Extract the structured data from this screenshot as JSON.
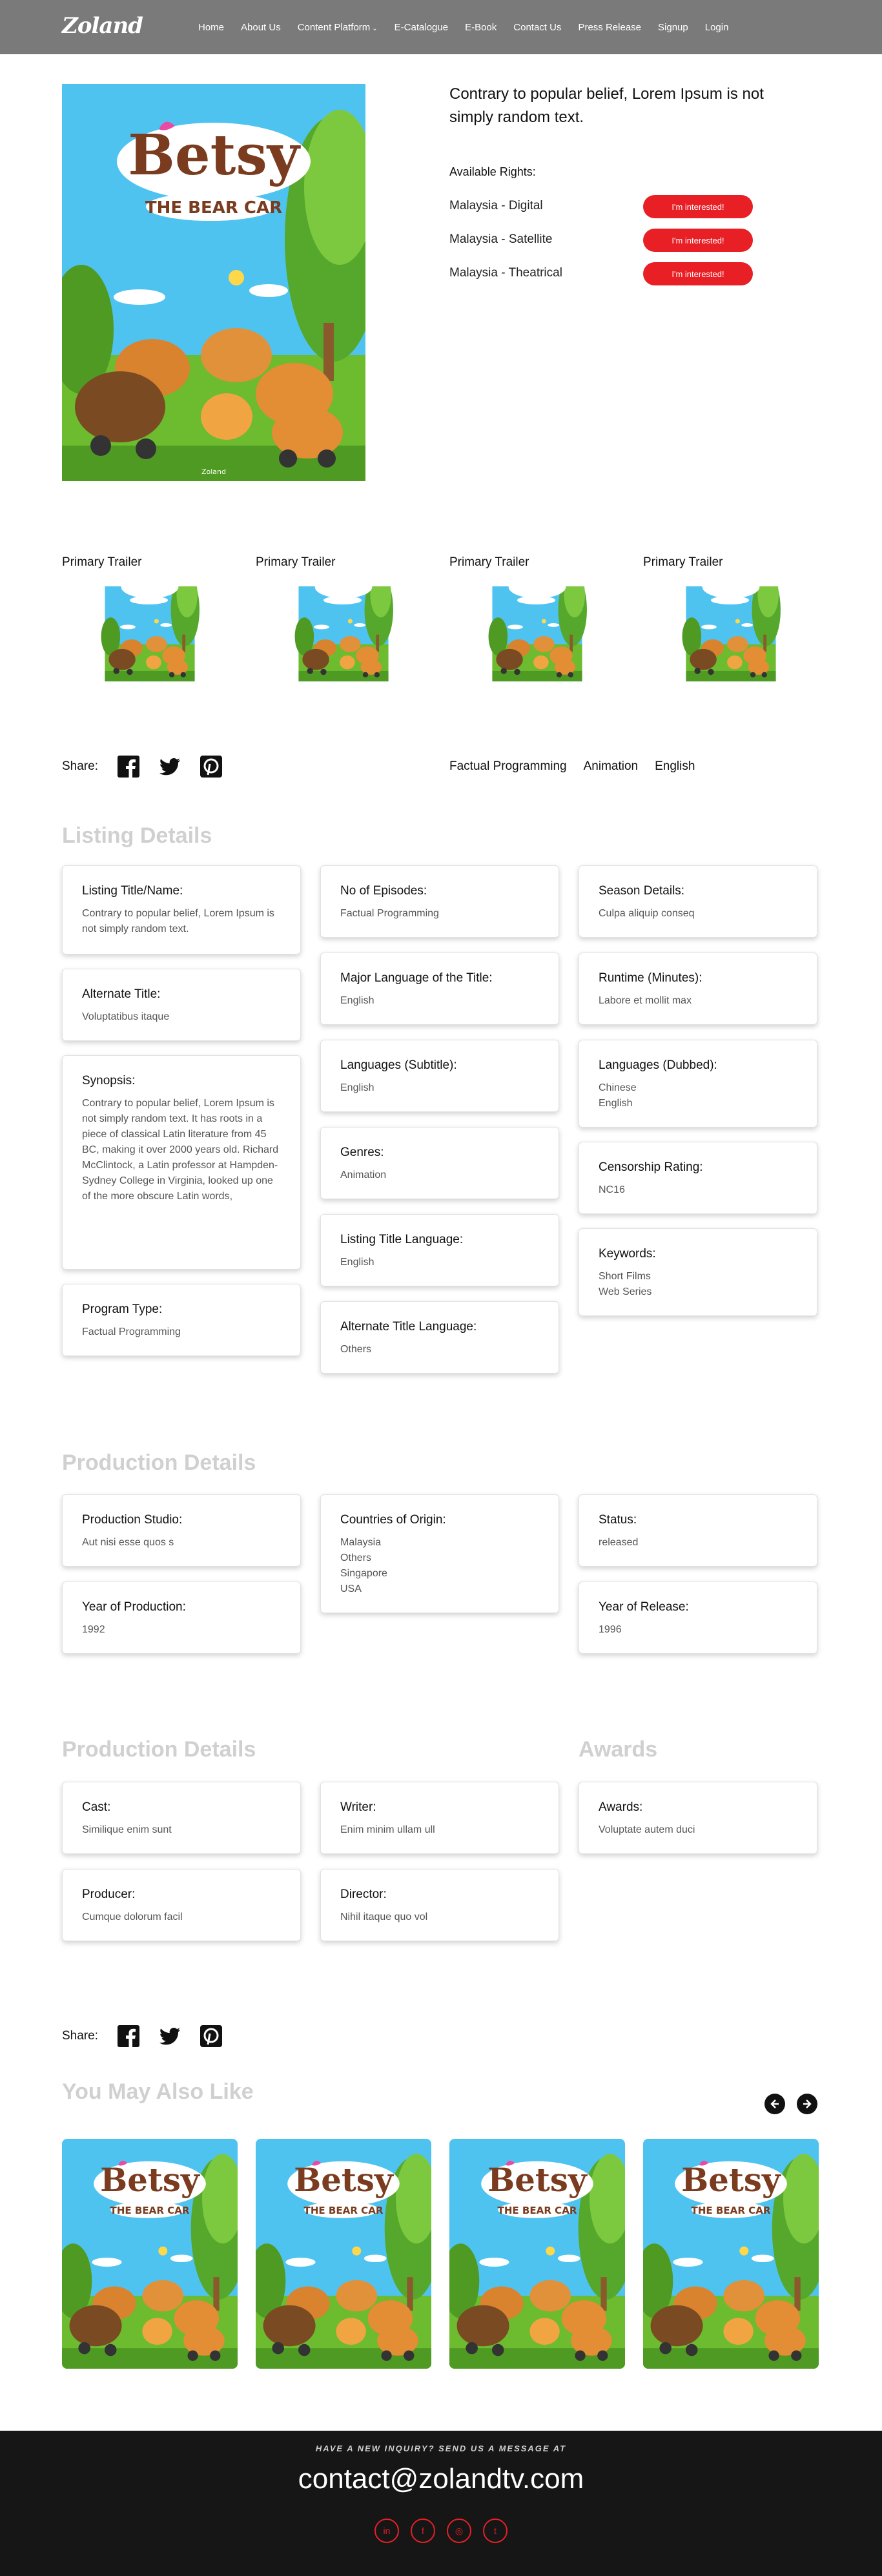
{
  "header": {
    "logo": "Zoland",
    "nav": [
      {
        "label": "Home"
      },
      {
        "label": "About Us"
      },
      {
        "label": "Content Platform"
      },
      {
        "label": "E-Catalogue"
      },
      {
        "label": "E-Book"
      },
      {
        "label": "Contact Us"
      },
      {
        "label": "Press Release"
      },
      {
        "label": "Signup"
      },
      {
        "label": "Login"
      }
    ]
  },
  "hero": {
    "poster_title": "Betsy",
    "poster_subtitle": "THE BEAR CAR",
    "poster_credit": "Zoland",
    "title": "Contrary to popular belief, Lorem Ipsum is not simply random text.",
    "rights_heading": "Available Rights:",
    "rights": [
      {
        "label": "Malaysia - Digital",
        "button": "I'm interested!"
      },
      {
        "label": "Malaysia - Satellite",
        "button": "I'm interested!"
      },
      {
        "label": "Malaysia - Theatrical",
        "button": "I'm interested!"
      }
    ]
  },
  "trailers": [
    {
      "label": "Primary Trailer"
    },
    {
      "label": "Primary Trailer"
    },
    {
      "label": "Primary Trailer"
    },
    {
      "label": "Primary Trailer"
    }
  ],
  "share": {
    "label": "Share:",
    "icons": [
      "facebook-icon",
      "twitter-icon",
      "pinterest-icon"
    ]
  },
  "tags": [
    "Factual Programming",
    "Animation",
    "English"
  ],
  "listing": {
    "title": "Listing Details",
    "col1": [
      {
        "label": "Listing Title/Name:",
        "value": "Contrary to popular belief, Lorem Ipsum is not simply random text."
      },
      {
        "label": "Alternate Title:",
        "value": "Voluptatibus itaque"
      },
      {
        "label": "Synopsis:",
        "value": "Contrary to popular belief, Lorem Ipsum is not simply random text. It has roots in a piece of classical Latin literature from 45 BC, making it over 2000 years old. Richard McClintock, a Latin professor at Hampden-Sydney College in Virginia, looked up one of the more obscure Latin words,"
      },
      {
        "label": "Program Type:",
        "value": "Factual Programming"
      }
    ],
    "col2": [
      {
        "label": "No of Episodes:",
        "value": "Factual Programming"
      },
      {
        "label": "Major Language of the Title:",
        "value": "English"
      },
      {
        "label": "Languages (Subtitle):",
        "value": "English"
      },
      {
        "label": "Genres:",
        "value": "Animation"
      },
      {
        "label": "Listing Title Language:",
        "value": "English"
      },
      {
        "label": "Alternate Title Language:",
        "value": "Others"
      }
    ],
    "col3": [
      {
        "label": "Season Details:",
        "value": "Culpa aliquip conseq"
      },
      {
        "label": "Runtime (Minutes):",
        "value": "Labore et mollit max"
      },
      {
        "label": "Languages (Dubbed):",
        "value": "Chinese\nEnglish"
      },
      {
        "label": "Censorship Rating:",
        "value": "NC16"
      },
      {
        "label": "Keywords:",
        "value": "Short Films\nWeb Series"
      }
    ]
  },
  "production": {
    "title": "Production Details",
    "studio": {
      "label": "Production Studio:",
      "value": "Aut nisi esse quos s"
    },
    "year_production": {
      "label": "Year of Production:",
      "value": "1992"
    },
    "countries": {
      "label": "Countries of Origin:",
      "value": "Malaysia\nOthers\nSingapore\nUSA"
    },
    "status": {
      "label": "Status:",
      "value": "released"
    },
    "year_release": {
      "label": "Year of Release:",
      "value": "1996"
    }
  },
  "crew": {
    "title": "Production Details",
    "cast": {
      "label": "Cast:",
      "value": "Similique enim sunt"
    },
    "writer": {
      "label": "Writer:",
      "value": "Enim minim ullam ull"
    },
    "producer": {
      "label": "Producer:",
      "value": "Cumque dolorum facil"
    },
    "director": {
      "label": "Director:",
      "value": "Nihil itaque quo vol"
    }
  },
  "awards": {
    "title": "Awards",
    "awards": {
      "label": "Awards:",
      "value": "Voluptate autem duci"
    }
  },
  "also_like": {
    "title": "You May Also Like",
    "count": 4
  },
  "footer": {
    "tagline": "HAVE A NEW INQUIRY? SEND US A MESSAGE AT",
    "email": "contact@zolandtv.com",
    "socials": [
      "in",
      "f",
      "◎",
      "t"
    ]
  },
  "colors": {
    "accent": "#e81f24",
    "header_bg": "#7a7a7a",
    "footer_bg": "#161616",
    "section_title": "#d0d0d0"
  }
}
